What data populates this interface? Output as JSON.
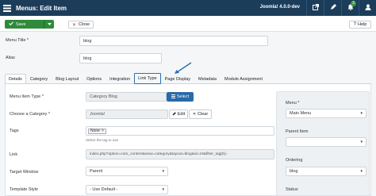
{
  "header": {
    "title": "Menus: Edit Item",
    "version": "Joomla! 4.0.0-dev",
    "notifications_count": "3"
  },
  "toolbar": {
    "save_label": "Save",
    "close_label": "Close",
    "help_label": "Help"
  },
  "fields": {
    "menu_title_label": "Menu Title *",
    "menu_title_value": "blog",
    "alias_label": "Alias",
    "alias_value": "blog"
  },
  "tabs": [
    "Details",
    "Category",
    "Blog Layout",
    "Options",
    "Integration",
    "Link Type",
    "Page Display",
    "Metadata",
    "Module Assignment"
  ],
  "details": {
    "menu_item_type_label": "Menu Item Type *",
    "menu_item_type_value": "Category Blog",
    "select_label": "Select",
    "category_label": "Choose a Category *",
    "category_value": "Joomla!",
    "edit_label": "Edit",
    "clear_label": "Clear",
    "tags_label": "Tags",
    "tag_chip": "None",
    "tags_hint": "Select the tag to use",
    "link_label": "Link",
    "link_value": "index.php?option=com_content&view=category&layout=blog&id=19&filter_tag[0]=",
    "target_label": "Target Window",
    "target_value": "Parent",
    "template_label": "Template Style",
    "template_value": "- Use Default -"
  },
  "sidebar": {
    "menu_label": "Menu *",
    "menu_value": "Main Menu",
    "parent_label": "Parent Item",
    "ordering_label": "Ordering",
    "ordering_value": "blog",
    "status_label": "Status"
  },
  "colors": {
    "header_bg": "#1c3d5a",
    "save_green": "#2f8a3b",
    "select_blue": "#2a6aa8",
    "highlight_blue": "#2a6fb3"
  }
}
